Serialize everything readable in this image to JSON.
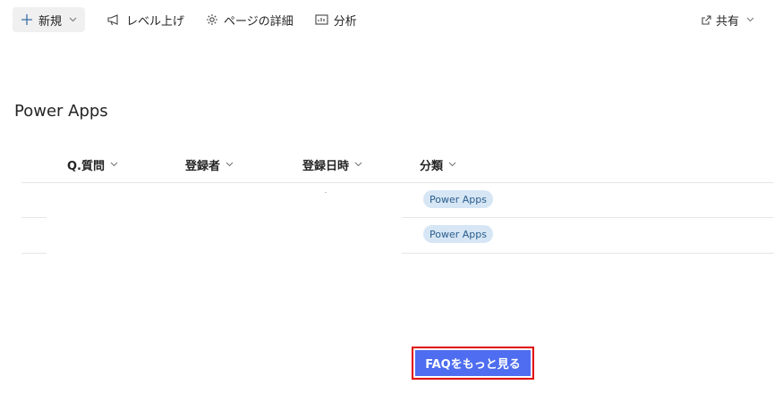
{
  "toolbar": {
    "new_label": "新規",
    "boost_label": "レベル上げ",
    "page_details_label": "ページの詳細",
    "analytics_label": "分析",
    "share_label": "共有"
  },
  "page": {
    "title": "Power Apps"
  },
  "list": {
    "columns": [
      "Q.質問",
      "登録者",
      "登録日時",
      "分類"
    ],
    "rows": [
      {
        "category": "Power Apps"
      },
      {
        "category": "Power Apps"
      }
    ]
  },
  "faq_button": {
    "label": "FAQをもっと見る"
  },
  "colors": {
    "accent": "#4e6df0",
    "highlight_border": "#e00000",
    "pill_bg": "#d6e6f5"
  }
}
